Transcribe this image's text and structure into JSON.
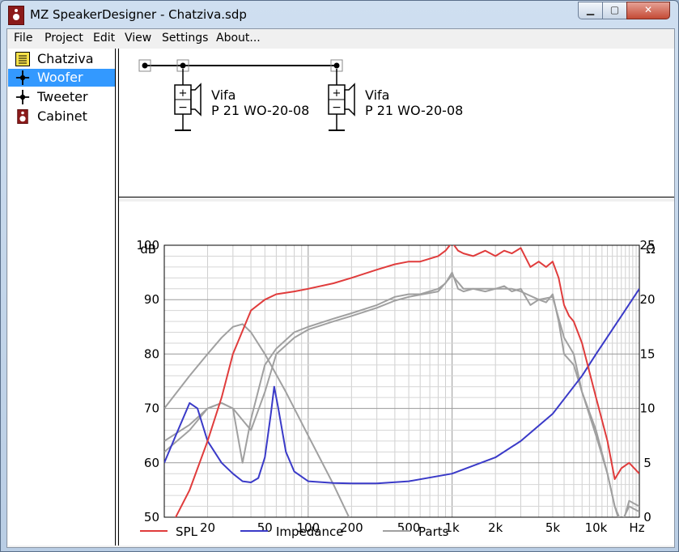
{
  "window": {
    "title": "MZ SpeakerDesigner - Chatziva.sdp",
    "min_label": "▁",
    "max_label": "▢",
    "close_label": "✕"
  },
  "menu": [
    "File",
    "Project",
    "Edit",
    "View",
    "Settings",
    "About..."
  ],
  "tree": [
    {
      "label": "Chatziva",
      "icon": "notes-icon",
      "selected": false
    },
    {
      "label": "Woofer",
      "icon": "driver-node-icon",
      "selected": true
    },
    {
      "label": "Tweeter",
      "icon": "driver-node-icon",
      "selected": false
    },
    {
      "label": "Cabinet",
      "icon": "cabinet-icon",
      "selected": false
    }
  ],
  "schematic": {
    "drivers": [
      {
        "brand": "Vifa",
        "model": "P 21 WO-20-08"
      },
      {
        "brand": "Vifa",
        "model": "P 21 WO-20-08"
      }
    ]
  },
  "colors": {
    "spl": "#e03c3c",
    "impedance": "#3a3ac8",
    "parts": "#a0a0a0",
    "selection": "#3399ff"
  },
  "chart_data": {
    "type": "line",
    "xscale": "log",
    "xlim": [
      10,
      20000
    ],
    "ylim": [
      50,
      100
    ],
    "y2lim": [
      0,
      25
    ],
    "ylabel": "dB",
    "y2label": "Ω",
    "xlabel": "Hz",
    "xtick_labels": [
      "20",
      "50",
      "100",
      "200",
      "500",
      "1k",
      "2k",
      "5k",
      "10k"
    ],
    "xtick_values": [
      20,
      50,
      100,
      200,
      500,
      1000,
      2000,
      5000,
      10000
    ],
    "ytick_labels": [
      "50",
      "60",
      "70",
      "80",
      "90",
      "100"
    ],
    "y2tick_labels": [
      "0",
      "5",
      "10",
      "15",
      "20",
      "25"
    ],
    "grid": true,
    "legend_position": "bottom",
    "series": [
      {
        "name": "SPL",
        "axis": "left",
        "x": [
          10,
          12,
          15,
          20,
          25,
          30,
          40,
          50,
          60,
          80,
          100,
          150,
          200,
          300,
          400,
          500,
          600,
          800,
          900,
          1000,
          1100,
          1200,
          1400,
          1700,
          2000,
          2300,
          2600,
          3000,
          3500,
          4000,
          4500,
          5000,
          5500,
          6000,
          6500,
          7000,
          8000,
          10000,
          12000,
          13500,
          15000,
          17000,
          20000
        ],
        "y": [
          46,
          50,
          55,
          64,
          72,
          80,
          88,
          90,
          91,
          91.5,
          92,
          93,
          94,
          95.5,
          96.5,
          97,
          97,
          98,
          99,
          100.5,
          99,
          98.5,
          98,
          99,
          98,
          99,
          98.5,
          99.5,
          96,
          97,
          96,
          97,
          94,
          89,
          87,
          86,
          82,
          72,
          64,
          57,
          59,
          60,
          58
        ]
      },
      {
        "name": "Impedance",
        "axis": "right",
        "x": [
          10,
          12,
          15,
          17,
          20,
          25,
          30,
          35,
          40,
          45,
          50,
          55,
          58,
          62,
          70,
          80,
          100,
          150,
          200,
          300,
          500,
          1000,
          2000,
          3000,
          5000,
          8000,
          10000,
          15000,
          20000
        ],
        "y": [
          5,
          7.5,
          10.5,
          10,
          7,
          5,
          4,
          3.3,
          3.2,
          3.6,
          5.5,
          9.5,
          12,
          10,
          6,
          4.2,
          3.3,
          3.15,
          3.1,
          3.1,
          3.3,
          4,
          5.5,
          7,
          9.5,
          13,
          15,
          18.5,
          21
        ]
      },
      {
        "name": "Parts",
        "axis": "left",
        "x": [
          10,
          15,
          20,
          25,
          30,
          35,
          40,
          50,
          60,
          80,
          100,
          150,
          200,
          300,
          400,
          500,
          600,
          800,
          900,
          1000,
          1100,
          1200,
          1400,
          1700,
          2000,
          2300,
          2600,
          3000,
          3500,
          4000,
          4500,
          5000,
          5500,
          6000,
          7000,
          8000,
          10000,
          12000,
          13500,
          15000,
          17000,
          20000
        ],
        "y": [
          62,
          66,
          70,
          71,
          70,
          60,
          68,
          78,
          81,
          84,
          85,
          86.5,
          87.5,
          89,
          90.5,
          91,
          91,
          92,
          93,
          95,
          92,
          91.5,
          92,
          91.5,
          92,
          92.5,
          91.5,
          92,
          89,
          90,
          89.5,
          91,
          86,
          80,
          78,
          73,
          65,
          58,
          52,
          48,
          53,
          52
        ]
      },
      {
        "name": "",
        "axis": "left",
        "x": [
          10,
          15,
          20,
          25,
          30,
          40,
          50,
          60,
          80,
          100,
          150,
          200,
          300,
          400,
          500,
          800,
          1000,
          1200,
          1600,
          2000,
          2600,
          3000,
          4000,
          5000,
          6000,
          7000,
          8000,
          10000,
          12000,
          13500,
          15000,
          17000,
          20000
        ],
        "y": [
          64,
          67,
          70,
          71,
          70,
          66,
          73,
          80,
          83,
          84.5,
          86,
          87,
          88.5,
          89.8,
          90.5,
          91.5,
          94.5,
          92,
          92,
          92,
          92,
          91.5,
          90,
          90.5,
          83,
          80,
          73,
          66,
          58,
          52,
          49,
          52,
          51
        ]
      },
      {
        "name": "",
        "axis": "left",
        "x": [
          10,
          15,
          20,
          25,
          30,
          35,
          40,
          50,
          70,
          100,
          150,
          200,
          250,
          300
        ],
        "y": [
          70,
          76,
          80,
          83,
          85,
          85.5,
          84,
          80,
          73,
          65,
          56,
          49,
          44,
          40
        ]
      }
    ]
  }
}
